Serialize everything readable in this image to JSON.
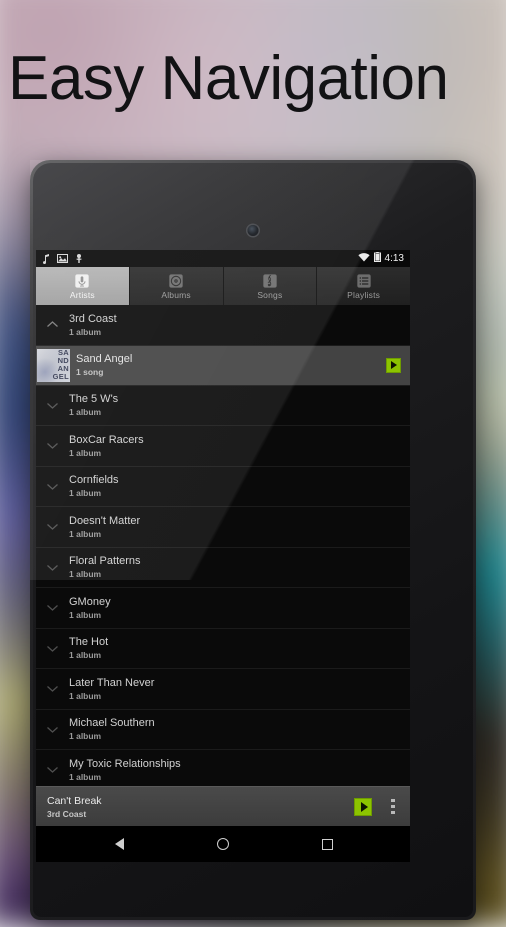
{
  "headline": "Easy Navigation",
  "status_bar": {
    "icons": [
      "music-note-icon",
      "screenshot-icon",
      "usb-icon"
    ],
    "wifi": "wifi-icon",
    "battery": "battery-icon",
    "time": "4:13"
  },
  "tabs": [
    {
      "label": "Artists",
      "icon": "microphone-icon",
      "selected": true
    },
    {
      "label": "Albums",
      "icon": "disc-icon",
      "selected": false
    },
    {
      "label": "Songs",
      "icon": "treble-clef-icon",
      "selected": false
    },
    {
      "label": "Playlists",
      "icon": "list-icon",
      "selected": false
    }
  ],
  "list": [
    {
      "type": "artist",
      "title": "3rd Coast",
      "subtitle": "1 album",
      "expanded": true
    },
    {
      "type": "album",
      "title": "Sand Angel",
      "subtitle": "1 song",
      "art_text": "SA\nND\nAN\nGEL"
    },
    {
      "type": "artist",
      "title": "The 5 W's",
      "subtitle": "1 album",
      "expanded": false
    },
    {
      "type": "artist",
      "title": "BoxCar Racers",
      "subtitle": "1 album",
      "expanded": false
    },
    {
      "type": "artist",
      "title": "Cornfields",
      "subtitle": "1 album",
      "expanded": false
    },
    {
      "type": "artist",
      "title": "Doesn't Matter",
      "subtitle": "1 album",
      "expanded": false
    },
    {
      "type": "artist",
      "title": "Floral Patterns",
      "subtitle": "1 album",
      "expanded": false
    },
    {
      "type": "artist",
      "title": "GMoney",
      "subtitle": "1 album",
      "expanded": false
    },
    {
      "type": "artist",
      "title": "The Hot",
      "subtitle": "1 album",
      "expanded": false
    },
    {
      "type": "artist",
      "title": "Later Than Never",
      "subtitle": "1 album",
      "expanded": false
    },
    {
      "type": "artist",
      "title": "Michael Southern",
      "subtitle": "1 album",
      "expanded": false
    },
    {
      "type": "artist",
      "title": "My Toxic Relationships",
      "subtitle": "1 album",
      "expanded": false
    }
  ],
  "now_playing": {
    "title": "Can't Break",
    "artist": "3rd Coast",
    "play_icon": "play-icon",
    "overflow_icon": "overflow-menu-icon"
  },
  "nav_bar": {
    "back": "back-icon",
    "home": "home-icon",
    "recents": "recents-icon"
  },
  "colors": {
    "accent_green": "#8cc400",
    "selected_tab": "#b4b4b4",
    "screen_bg": "#050505"
  }
}
